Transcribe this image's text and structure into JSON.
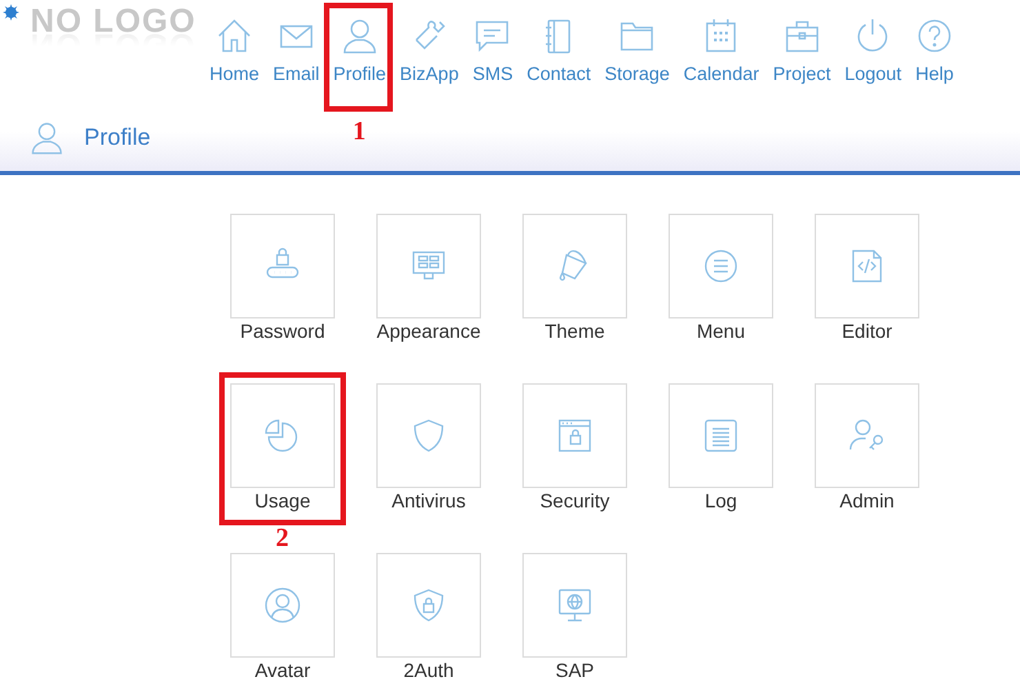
{
  "logo": "NO LOGO",
  "nav": [
    {
      "label": "Home"
    },
    {
      "label": "Email"
    },
    {
      "label": "Profile",
      "callout": "1"
    },
    {
      "label": "BizApp"
    },
    {
      "label": "SMS"
    },
    {
      "label": "Contact"
    },
    {
      "label": "Storage"
    },
    {
      "label": "Calendar"
    },
    {
      "label": "Project"
    },
    {
      "label": "Logout"
    },
    {
      "label": "Help"
    }
  ],
  "page_title": "Profile",
  "tiles": [
    {
      "label": "Password"
    },
    {
      "label": "Appearance"
    },
    {
      "label": "Theme"
    },
    {
      "label": "Menu"
    },
    {
      "label": "Editor"
    },
    {
      "label": "Usage",
      "callout": "2"
    },
    {
      "label": "Antivirus"
    },
    {
      "label": "Security"
    },
    {
      "label": "Log"
    },
    {
      "label": "Admin"
    },
    {
      "label": "Avatar"
    },
    {
      "label": "2Auth"
    },
    {
      "label": "SAP"
    }
  ]
}
